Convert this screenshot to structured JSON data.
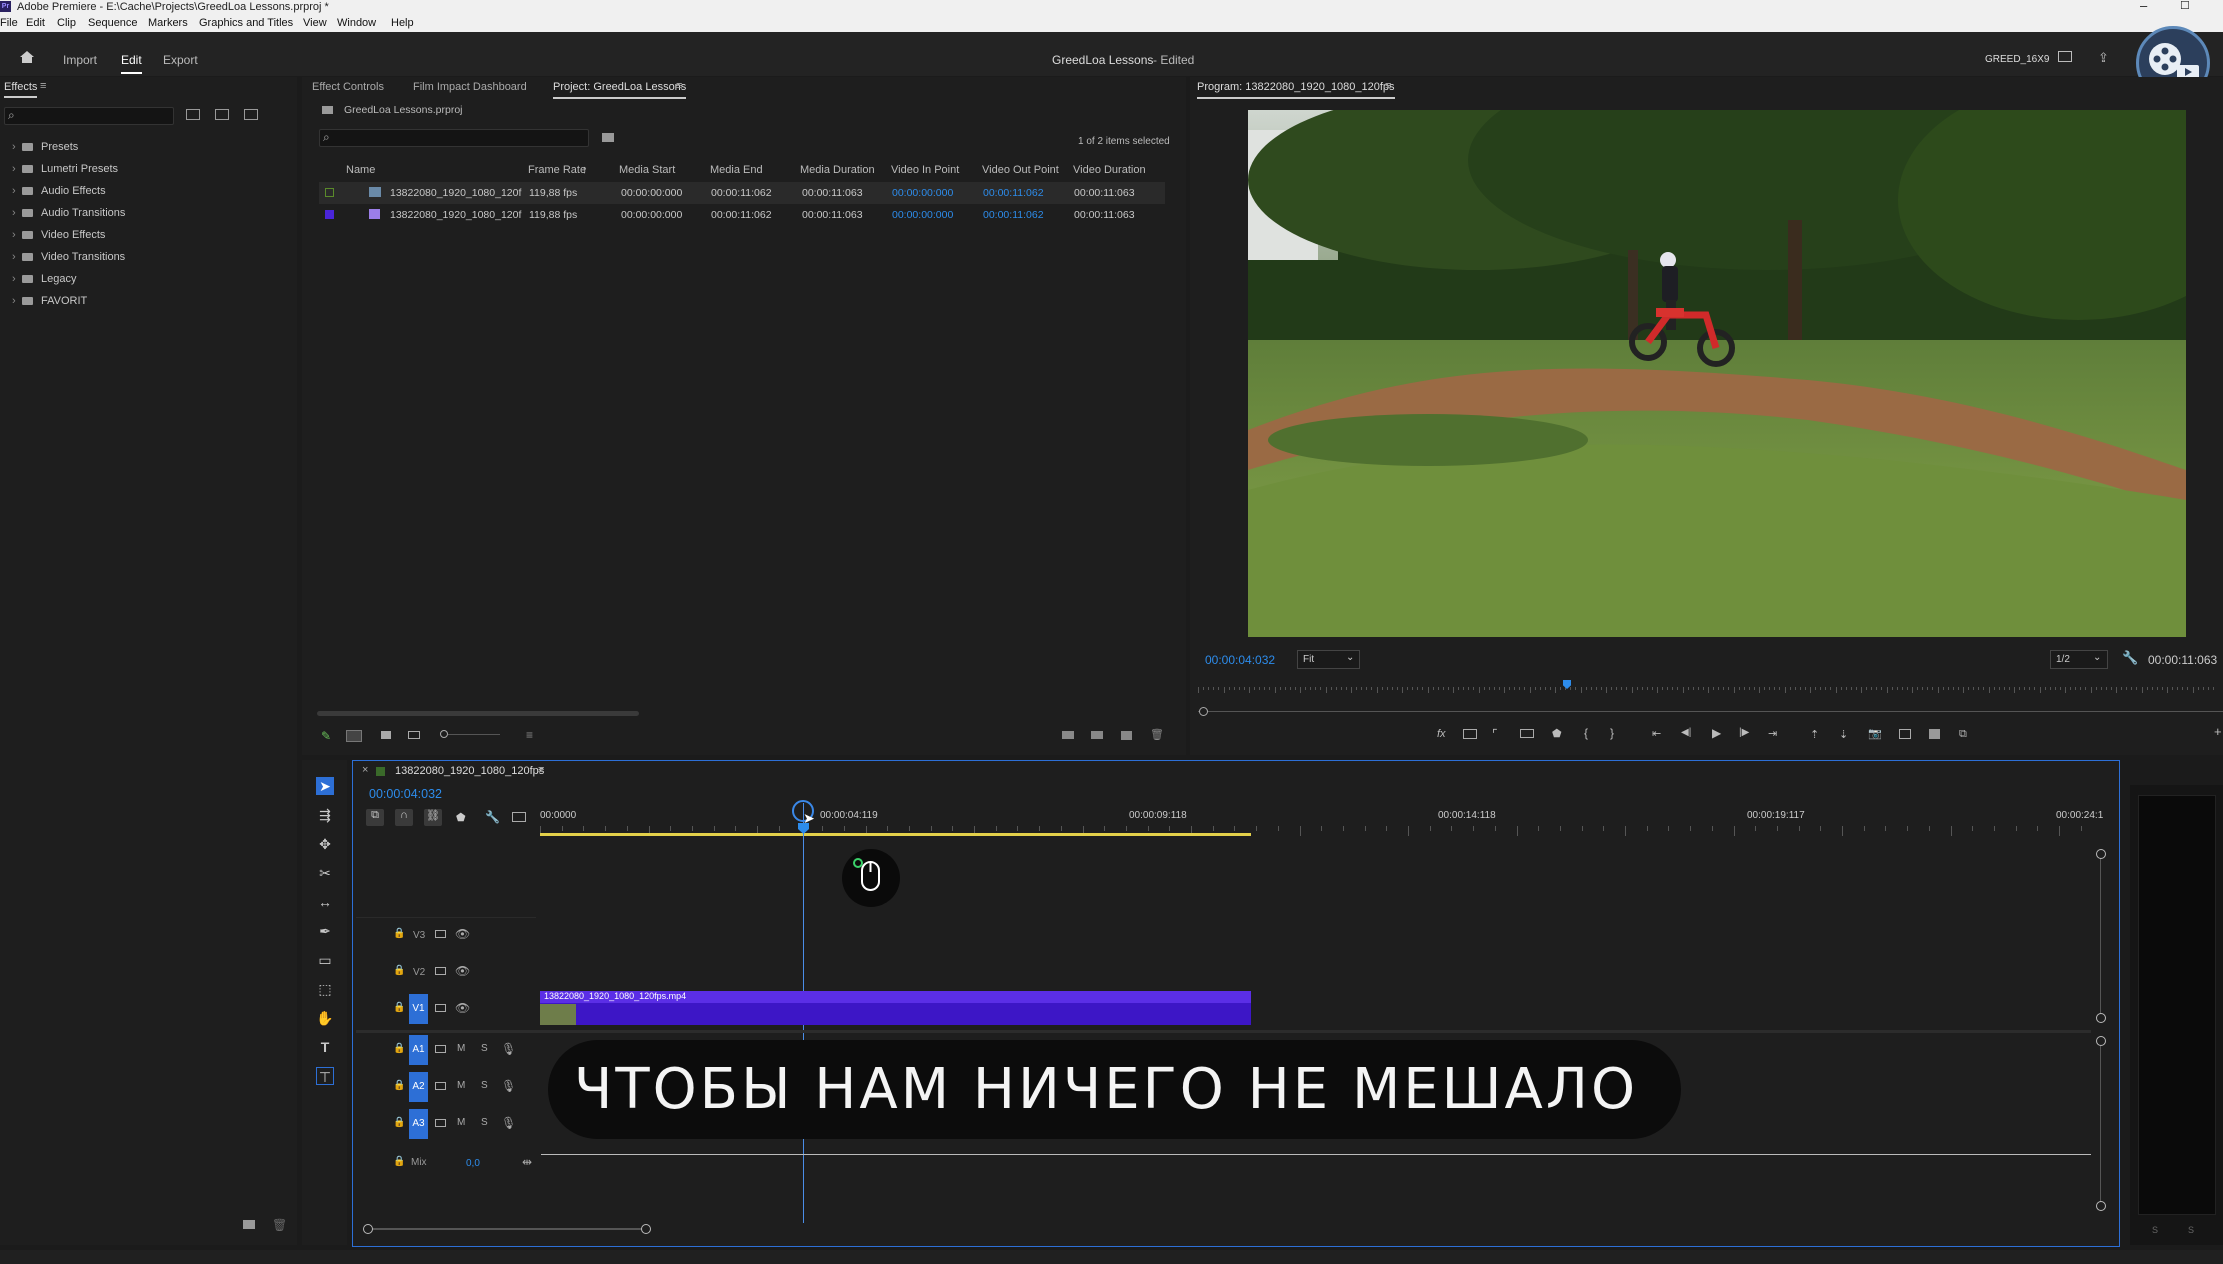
{
  "window": {
    "title": "Adobe Premiere - E:\\Cache\\Projects\\GreedLoa Lessons.prproj *",
    "app_icon": "Pr"
  },
  "menu": [
    "File",
    "Edit",
    "Clip",
    "Sequence",
    "Markers",
    "Graphics and Titles",
    "View",
    "Window",
    "Help"
  ],
  "appbar": {
    "tabs": [
      "Import",
      "Edit",
      "Export"
    ],
    "active_tab": "Edit",
    "center_title": "GreedLoa Lessons",
    "center_status": "- Edited",
    "workspace": "GREED_16X9"
  },
  "effects": {
    "title": "Effects",
    "items": [
      "Presets",
      "Lumetri Presets",
      "Audio Effects",
      "Audio Transitions",
      "Video Effects",
      "Video Transitions",
      "Legacy",
      "FAVORIT"
    ]
  },
  "project": {
    "tabs": [
      "Effect Controls",
      "Film Impact Dashboard",
      "Project: GreedLoa Lessons"
    ],
    "file": "GreedLoa Lessons.prproj",
    "selection": "1 of 2 items selected",
    "columns": [
      "Name",
      "Frame Rate",
      "Media Start",
      "Media End",
      "Media Duration",
      "Video In Point",
      "Video Out Point",
      "Video Duration"
    ],
    "rows": [
      {
        "name": "13822080_1920_1080_120f",
        "frame_rate": "119,88 fps",
        "media_start": "00:00:00:000",
        "media_end": "00:00:11:062",
        "media_duration": "00:00:11:063",
        "in_point": "00:00:00:000",
        "out_point": "00:00:11:062",
        "video_duration": "00:00:11:063",
        "color": "#5a8a2a"
      },
      {
        "name": "13822080_1920_1080_120f",
        "frame_rate": "119,88 fps",
        "media_start": "00:00:00:000",
        "media_end": "00:00:11:062",
        "media_duration": "00:00:11:063",
        "in_point": "00:00:00:000",
        "out_point": "00:00:11:062",
        "video_duration": "00:00:11:063",
        "color": "#4a25d8"
      }
    ]
  },
  "program": {
    "title": "Program: 13822080_1920_1080_120fps",
    "timecode": "00:00:04:032",
    "fit": "Fit",
    "resolution": "1/2",
    "duration": "00:00:11:063",
    "playhead_fraction": 0.36
  },
  "timeline": {
    "sequence_name": "13822080_1920_1080_120fps",
    "timecode": "00:00:04:032",
    "ruler_labels": [
      "00:0000",
      "00:00:04:119",
      "00:00:09:118",
      "00:00:14:118",
      "00:00:19:117",
      "00:00:24:1"
    ],
    "clip_name": "13822080_1920_1080_120fps.mp4",
    "video_tracks": [
      "V3",
      "V2",
      "V1"
    ],
    "audio_tracks": [
      "A1",
      "A2",
      "A3"
    ],
    "mix_label": "Mix",
    "mix_value": "0,0",
    "track_buttons": {
      "mute": "M",
      "solo": "S"
    }
  },
  "subtitle": "ЧТОБЫ НАМ НИЧЕГО НЕ МЕШАЛО",
  "colors": {
    "accent": "#2d8ceb",
    "clip": "#3d16c6",
    "clip_header": "#5b2ee6",
    "work_area": "#e3d04a"
  }
}
